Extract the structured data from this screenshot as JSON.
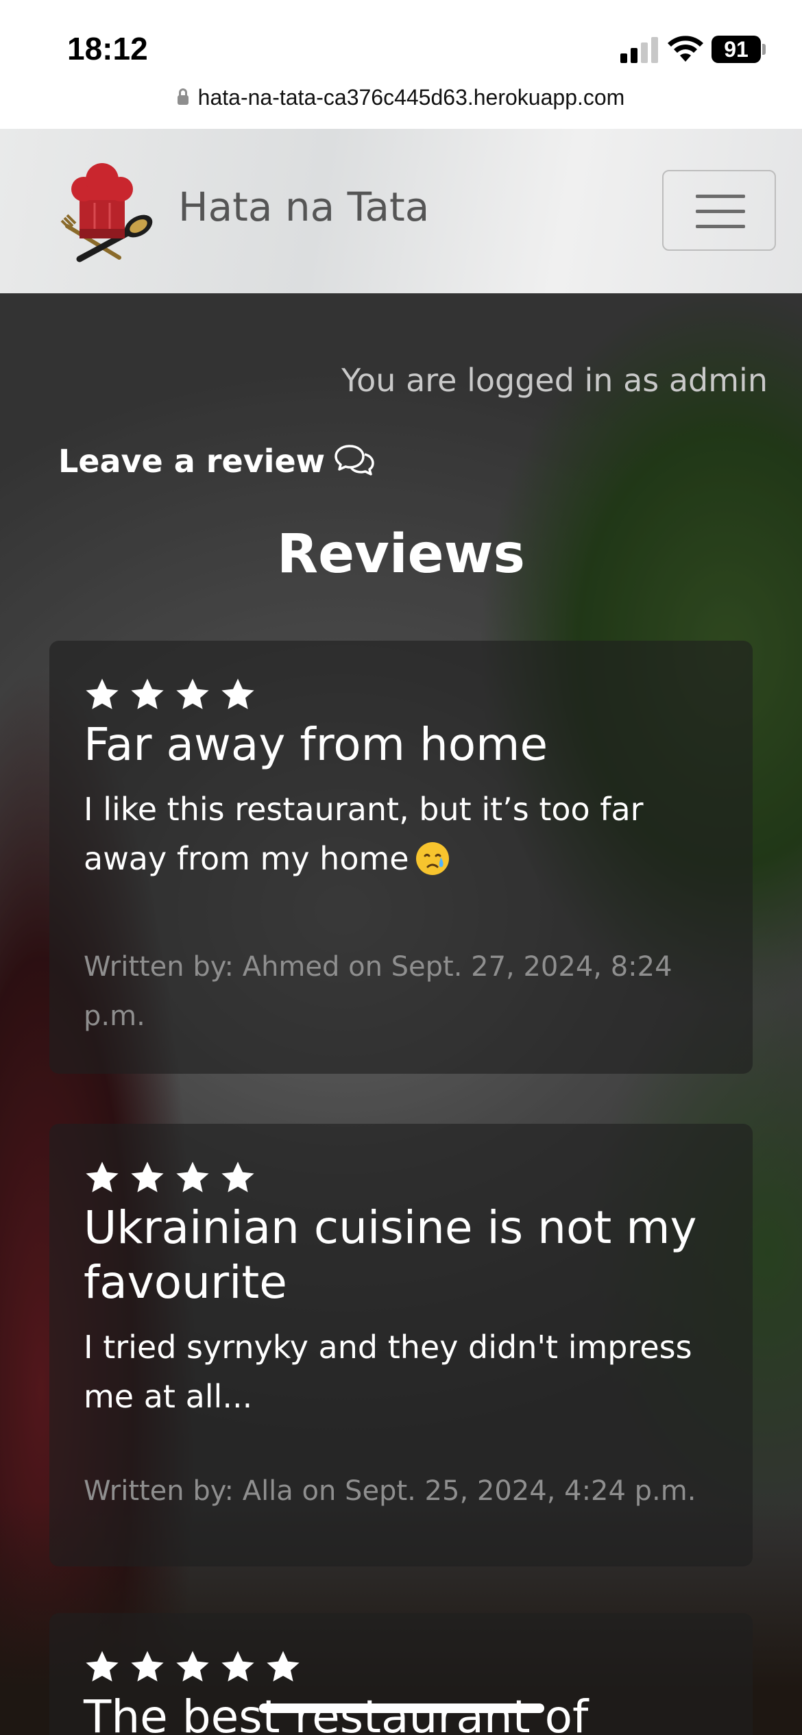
{
  "status_bar": {
    "time": "18:12",
    "battery": "91",
    "url": "hata-na-tata-ca376c445d63.herokuapp.com"
  },
  "navbar": {
    "brand": "Hata na Tata"
  },
  "main": {
    "logged_in_text": "You are logged in as admin",
    "leave_review_label": "Leave a review",
    "section_title": "Reviews",
    "reviews": [
      {
        "rating": 4,
        "title": "Far away from home",
        "body": "I like this restaurant, but it’s too far away from my home",
        "emoji": "crying-face",
        "meta": "Written by: Ahmed on Sept. 27, 2024, 8:24 p.m."
      },
      {
        "rating": 4,
        "title": "Ukrainian cuisine is not my favourite",
        "body": "I tried syrnyky and they didn't impress me at all...",
        "meta": "Written by: Alla on Sept. 25, 2024, 4:24 p.m."
      },
      {
        "rating": 5,
        "title": "The best restaurant of"
      }
    ]
  },
  "colors": {
    "brand_text": "#555555",
    "star": "#ffffff",
    "meta_text": "#8f8f8f"
  }
}
